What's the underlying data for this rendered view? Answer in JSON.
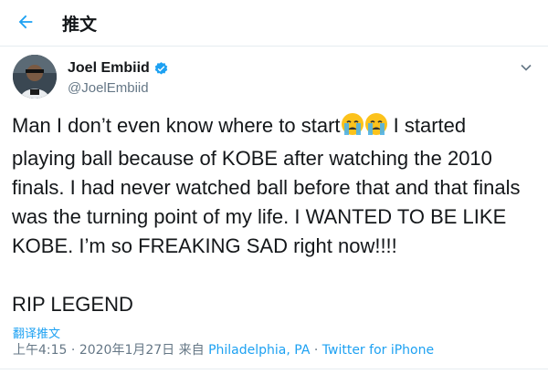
{
  "header": {
    "title": "推文"
  },
  "author": {
    "name": "Joel Embiid",
    "handle": "@JoelEmbiid",
    "verified": true
  },
  "tweet": {
    "line1": "Man I don’t even know where to start",
    "line1_after_emoji": " I started",
    "rest": "playing ball because of KOBE after watching the 2010 finals. I had never watched ball before that and that finals was the turning point of my life. I WANTED TO BE LIKE KOBE. I’m so FREAKING SAD right now!!!!",
    "blank": "",
    "closing": "RIP LEGEND",
    "emojis": [
      "crying-face-icon",
      "crying-face-icon"
    ]
  },
  "translate_label": "翻译推文",
  "meta": {
    "time": "上午4:15",
    "separator1": " · ",
    "date": "2020年1月27日",
    "from_label": " 来自 ",
    "location": "Philadelphia, PA",
    "separator2": " · ",
    "source": "Twitter for iPhone"
  },
  "colors": {
    "accent": "#1da1f2",
    "secondary_text": "#657786",
    "text": "#14171a"
  }
}
